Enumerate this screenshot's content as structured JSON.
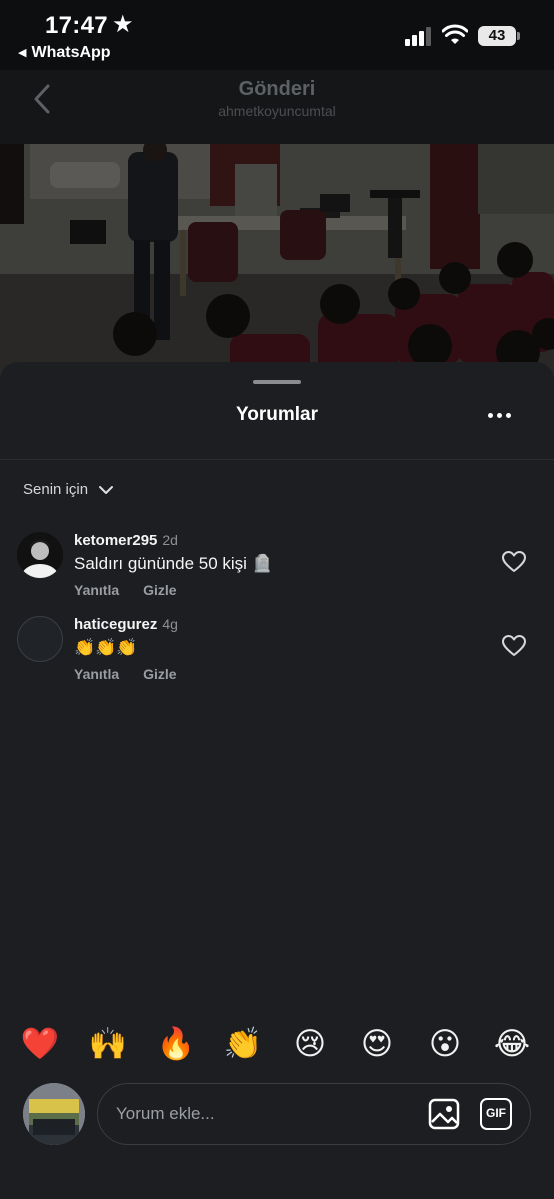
{
  "status_bar": {
    "time": "17:47",
    "star": "★",
    "back_app": "WhatsApp",
    "battery": "43"
  },
  "nav": {
    "title": "Gönderi",
    "subtitle": "ahmetkoyuncumtal"
  },
  "sheet": {
    "title": "Yorumlar",
    "filter_label": "Senin için"
  },
  "comments": [
    {
      "username": "ketomer295",
      "time": "2d",
      "text": "Saldırı gününde 50 kişi 🪦",
      "reply_label": "Yanıtla",
      "hide_label": "Gizle"
    },
    {
      "username": "haticegurez",
      "time": "4g",
      "text": "👏👏👏",
      "reply_label": "Yanıtla",
      "hide_label": "Gizle"
    }
  ],
  "quick_reactions": [
    "❤️",
    "🙌",
    "🔥",
    "👏",
    "😢",
    "😍",
    "😮",
    "😂"
  ],
  "composer": {
    "placeholder": "Yorum ekle...",
    "gif_label": "GIF"
  },
  "icons": {
    "back": "chevron-left-icon",
    "more": "more-horizontal-icon",
    "filter": "chevron-down-icon",
    "like": "heart-outline-icon",
    "image": "image-icon",
    "gif": "gif-icon"
  },
  "colors": {
    "background": "#0d0e10",
    "sheet": "#1c1e21",
    "text_primary": "#f4f4f4",
    "text_secondary": "#9a9da2"
  }
}
